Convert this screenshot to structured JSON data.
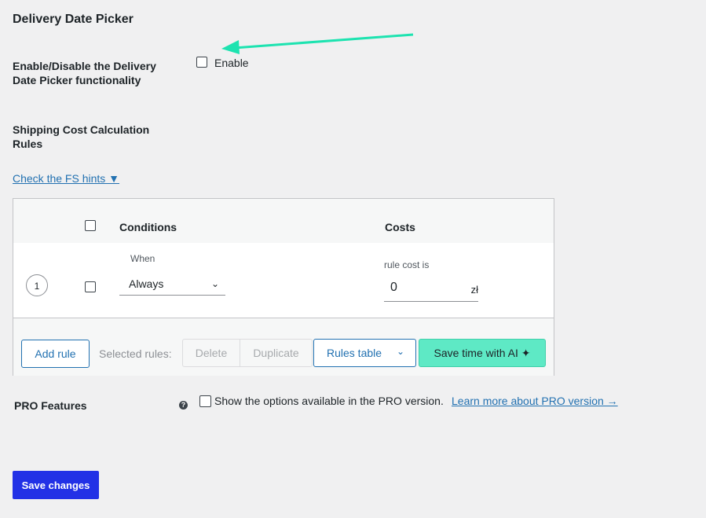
{
  "section": {
    "title": "Delivery Date Picker"
  },
  "enable": {
    "label": "Enable/Disable the Delivery Date Picker functionality",
    "checkbox_text": "Enable"
  },
  "shipping": {
    "label": "Shipping Cost Calculation Rules"
  },
  "hints_link": "Check the FS hints ▼",
  "rules_table": {
    "headers": {
      "conditions": "Conditions",
      "costs": "Costs"
    },
    "rows": [
      {
        "number": "1",
        "when_label": "When",
        "condition": "Always",
        "cost_label": "rule cost is",
        "cost": "0",
        "currency": "zł"
      }
    ],
    "footer": {
      "add_rule": "Add rule",
      "selected_rules": "Selected rules:",
      "delete": "Delete",
      "duplicate": "Duplicate",
      "rules_table": "Rules table",
      "save_ai": "Save time with AI ✦"
    }
  },
  "pro": {
    "label": "PRO Features",
    "help_icon": "?",
    "checkbox_text": "Show the options available in the PRO version.",
    "link": "Learn more about PRO version →"
  },
  "save_button": "Save changes",
  "colors": {
    "accent": "#2271b1",
    "ai_button": "#5ee9c5",
    "save_button": "#2231e6",
    "annotation_arrow": "#1de3b0"
  }
}
